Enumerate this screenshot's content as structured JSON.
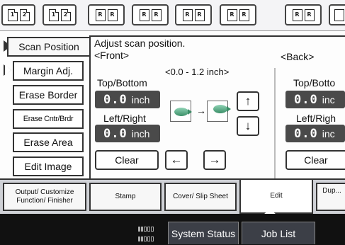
{
  "toolbar": {
    "modes": [
      {
        "name": "mode-1-sided-to-2-sided",
        "glyphs": [
          "1",
          "2"
        ]
      },
      {
        "name": "mode-2-sided-to-2-sided",
        "glyphs": [
          "1",
          "2"
        ]
      },
      {
        "name": "mode-reduce-1",
        "glyphs": [
          "R",
          "R"
        ]
      },
      {
        "name": "mode-reduce-2",
        "glyphs": [
          "R",
          "R"
        ]
      },
      {
        "name": "mode-reduce-3",
        "glyphs": [
          "R",
          "R"
        ]
      },
      {
        "name": "mode-reduce-4",
        "glyphs": [
          "R",
          "R"
        ]
      },
      {
        "name": "mode-reduce-5",
        "glyphs": [
          "R",
          "R"
        ]
      }
    ]
  },
  "side_tabs": [
    {
      "label": "Scan Position",
      "active": true
    },
    {
      "label": "Margin Adj.",
      "active": false
    },
    {
      "label": "Erase Border",
      "active": false
    },
    {
      "label": "Erase Cntr/Brdr",
      "active": false
    },
    {
      "label": "Erase Area",
      "active": false
    },
    {
      "label": "Edit Image",
      "active": false
    }
  ],
  "panel": {
    "instruction": "Adjust scan position.",
    "front_label": "<Front>",
    "back_label": "<Back>",
    "range": "<0.0 - 1.2 inch>",
    "front": {
      "top_bottom_label": "Top/Bottom",
      "top_bottom_value": "0.0",
      "left_right_label": "Left/Right",
      "left_right_value": "0.0",
      "unit": "inch",
      "clear_label": "Clear"
    },
    "back": {
      "top_bottom_label": "Top/Botto",
      "top_bottom_value": "0.0",
      "left_right_label": "Left/Righ",
      "left_right_value": "0.0",
      "unit": "inc",
      "clear_label": "Clear"
    },
    "arrows": {
      "up": "↑",
      "down": "↓",
      "left": "←",
      "right": "→"
    },
    "preview_arrow": "→"
  },
  "function_tabs": [
    {
      "label": "Output/ Customize Function/ Finisher",
      "active": false
    },
    {
      "label": "Stamp",
      "active": false
    },
    {
      "label": "Cover/ Slip Sheet",
      "active": false
    },
    {
      "label": "Edit",
      "active": true
    },
    {
      "label": "Dup...",
      "active": false
    }
  ],
  "status_bar": {
    "system_status": "System Status",
    "job_list": "Job List"
  },
  "colors": {
    "value_box": "#4a4a4a",
    "status_bar": "#111111",
    "status_button": "#3c3f47"
  }
}
